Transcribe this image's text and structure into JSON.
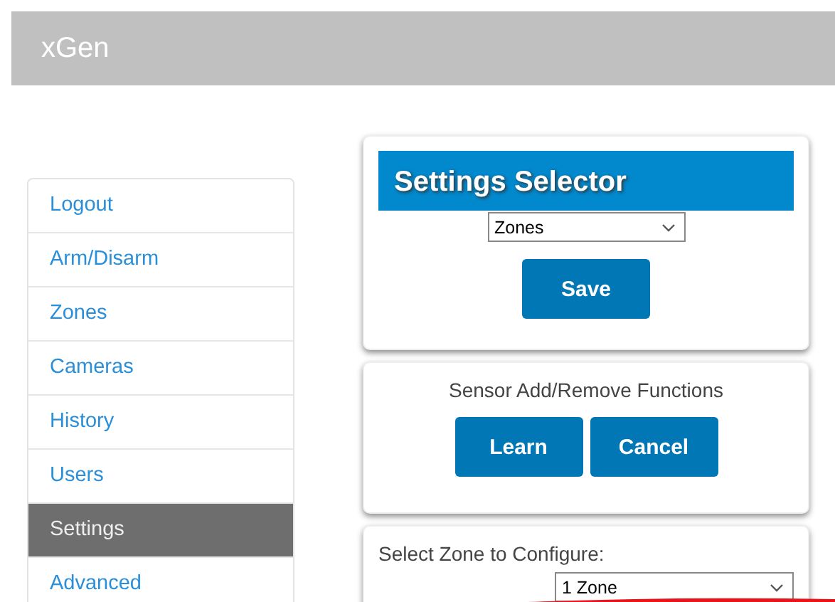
{
  "header": {
    "title": "xGen"
  },
  "sidebar": {
    "items": [
      {
        "label": "Logout",
        "selected": false
      },
      {
        "label": "Arm/Disarm",
        "selected": false
      },
      {
        "label": "Zones",
        "selected": false
      },
      {
        "label": "Cameras",
        "selected": false
      },
      {
        "label": "History",
        "selected": false
      },
      {
        "label": "Users",
        "selected": false
      },
      {
        "label": "Settings",
        "selected": true
      },
      {
        "label": "Advanced",
        "selected": false
      }
    ]
  },
  "settings_selector": {
    "title": "Settings Selector",
    "select_value": "Zones",
    "button": "Save"
  },
  "sensor_functions": {
    "title": "Sensor Add/Remove Functions",
    "buttons": [
      "Learn",
      "Cancel"
    ]
  },
  "zone_config": {
    "label": "Select Zone to Configure:",
    "select_value": "1 Zone"
  }
}
